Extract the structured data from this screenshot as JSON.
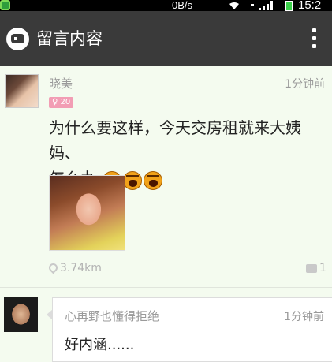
{
  "status_bar": {
    "speed": "0B/s",
    "time": "15:2"
  },
  "app_bar": {
    "title": "留言内容"
  },
  "post": {
    "username": "晓美",
    "time": "1分钟前",
    "badge": "20",
    "text_line1": "为什么要这样，今天交房租就来大姨妈、",
    "text_line2": "怎么办",
    "distance": "3.74km",
    "comment_count": "1"
  },
  "reply": {
    "username": "心再野也懂得拒绝",
    "time": "1分钟前",
    "text": "好内涵......"
  },
  "colors": {
    "app_bar_bg": "#3a3a3a",
    "card_bg": "#f4fbef",
    "badge_bg": "#f29db4"
  }
}
